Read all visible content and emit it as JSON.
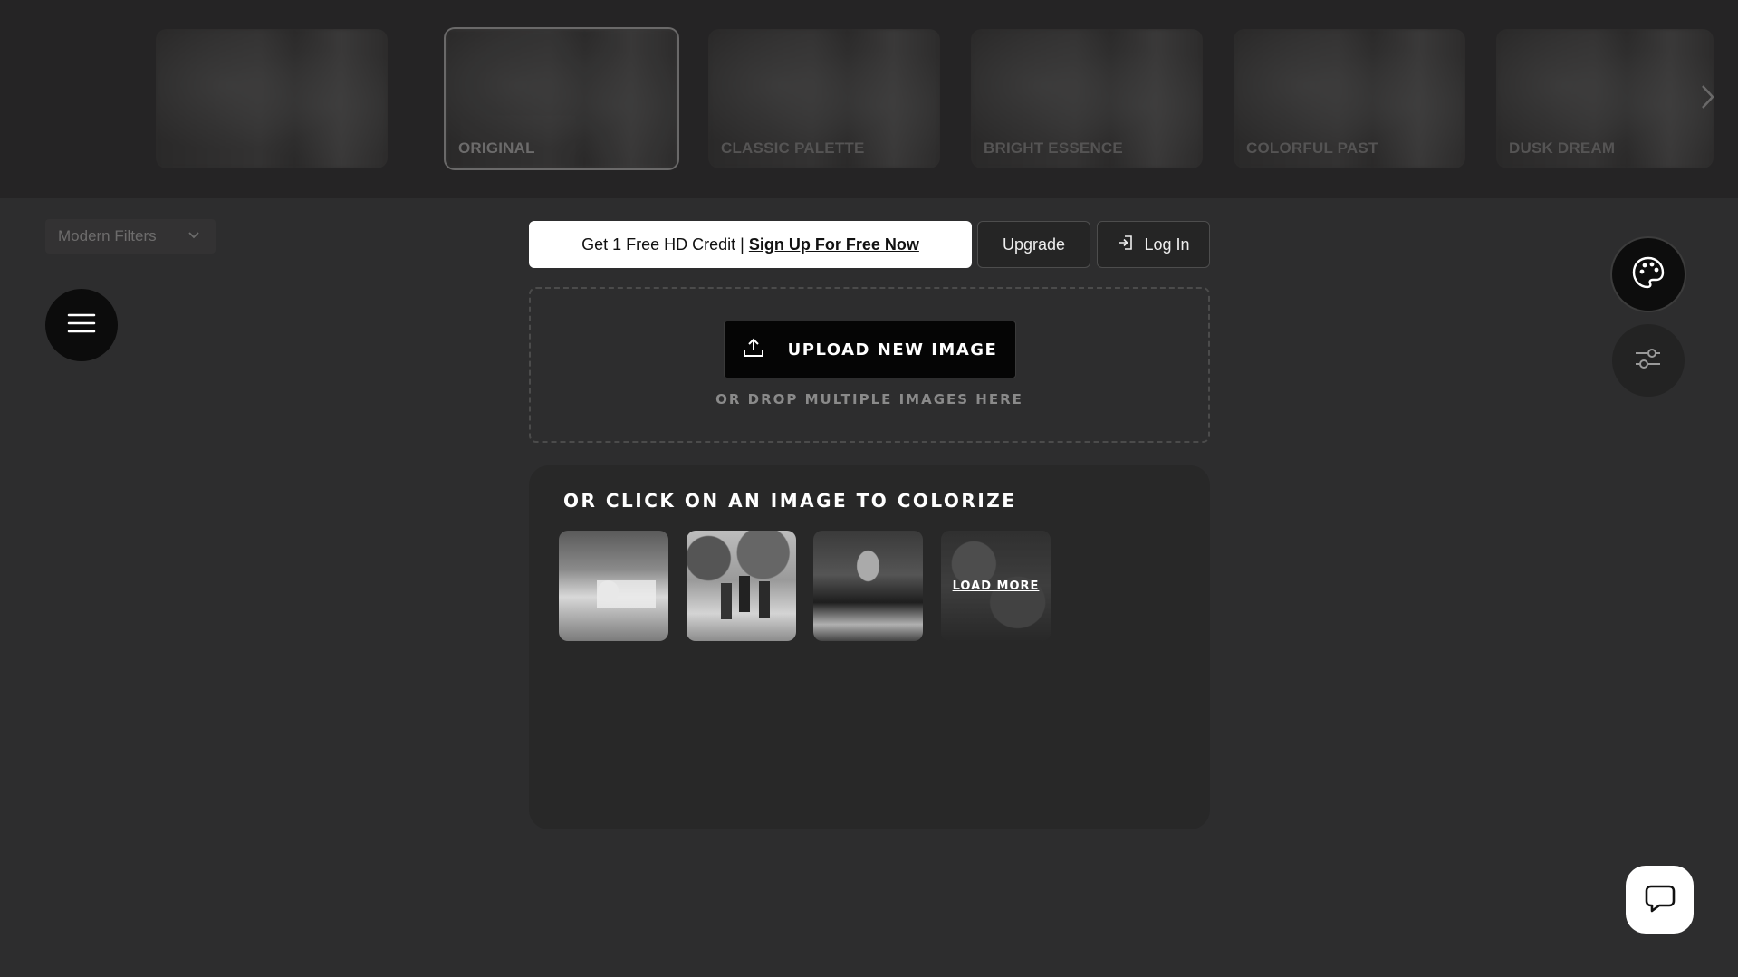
{
  "filter_strip": {
    "cards": [
      {
        "label": ""
      },
      {
        "label": "ORIGINAL"
      },
      {
        "label": "CLASSIC PALETTE"
      },
      {
        "label": "BRIGHT ESSENCE"
      },
      {
        "label": "COLORFUL PAST"
      },
      {
        "label": "DUSK DREAM"
      }
    ],
    "selected_index": 1,
    "next_icon": "chevron-right-icon"
  },
  "filters_dropdown": {
    "value": "Modern Filters",
    "icon": "chevron-down-icon"
  },
  "menu_button": {
    "icon": "hamburger-menu-icon"
  },
  "credit_banner": {
    "prefix": "Get 1 Free HD Credit |",
    "link": "Sign Up For Free Now"
  },
  "upgrade_button": {
    "label": "Upgrade"
  },
  "login_button": {
    "label": "Log In",
    "icon": "login-icon"
  },
  "upload": {
    "button_label": "UPLOAD NEW IMAGE",
    "icon": "upload-icon",
    "hint": "OR DROP MULTIPLE IMAGES HERE"
  },
  "samples": {
    "title": "OR CLICK ON AN IMAGE TO COLORIZE",
    "load_more": "LOAD MORE"
  },
  "side_tools": {
    "palette_icon": "palette-icon",
    "sliders_icon": "sliders-icon"
  },
  "chat": {
    "icon": "chat-bubble-icon"
  },
  "colors": {
    "background": "#2d2d2e",
    "strip": "#252425",
    "panel": "#282828",
    "accent_white": "#ffffff"
  }
}
